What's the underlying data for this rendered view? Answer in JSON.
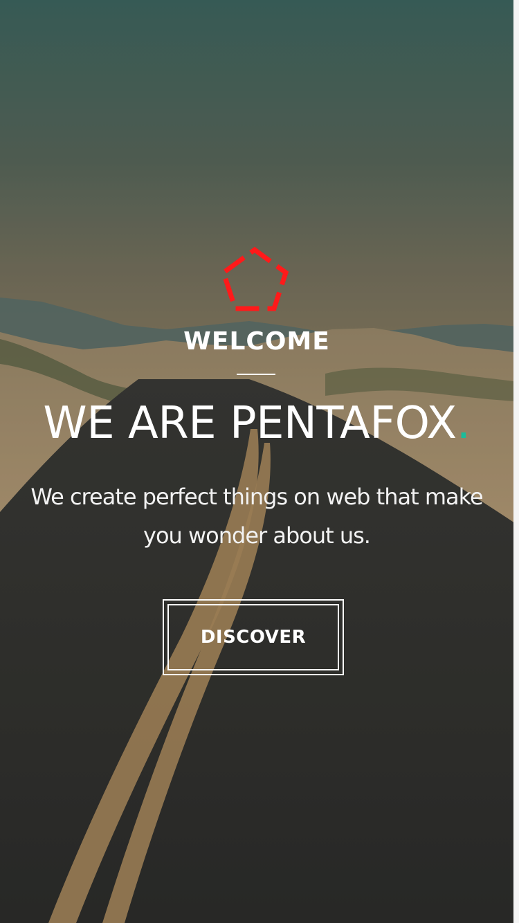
{
  "hero": {
    "welcome": "WELCOME",
    "headline": "WE ARE PENTAFOX",
    "headline_dot": ".",
    "subtitle_line1": "We create perfect things on web that make",
    "subtitle_line2": "you wonder about us.",
    "discover_label": "DISCOVER"
  },
  "colors": {
    "logo": "#ff1a1a",
    "accent_dot": "#1bbc9b",
    "text": "#ffffff"
  },
  "icons": {
    "logo": "pentagon-logo-icon"
  }
}
